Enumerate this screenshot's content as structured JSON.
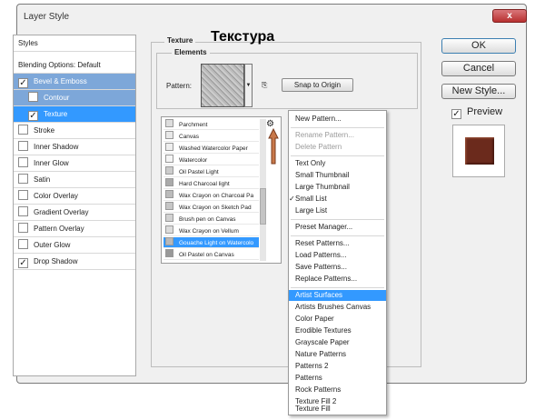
{
  "window": {
    "title": "Layer Style",
    "close_label": "x"
  },
  "styles_panel": {
    "header": "Styles",
    "blending": "Blending Options: Default",
    "items": [
      {
        "label": "Bevel & Emboss",
        "checked": true
      },
      {
        "label": "Contour",
        "checked": false
      },
      {
        "label": "Texture",
        "checked": true
      },
      {
        "label": "Stroke",
        "checked": false
      },
      {
        "label": "Inner Shadow",
        "checked": false
      },
      {
        "label": "Inner Glow",
        "checked": false
      },
      {
        "label": "Satin",
        "checked": false
      },
      {
        "label": "Color Overlay",
        "checked": false
      },
      {
        "label": "Gradient Overlay",
        "checked": false
      },
      {
        "label": "Pattern Overlay",
        "checked": false
      },
      {
        "label": "Outer Glow",
        "checked": false
      },
      {
        "label": "Drop Shadow",
        "checked": true
      }
    ]
  },
  "texture": {
    "legend": "Texture",
    "annotation": "Текстура",
    "elements_legend": "Elements",
    "pattern_label": "Pattern:",
    "snap_label": "Snap to Origin"
  },
  "pattern_list": [
    "Parchment",
    "Canvas",
    "Washed Watercolor Paper",
    "Watercolor",
    "Oil Pastel Light",
    "Hard Charcoal light",
    "Wax Crayon on Charcoal Pa",
    "Wax Crayon on Sketch Pad",
    "Brush pen on Canvas",
    "Wax Crayon on Vellum",
    "Gouache Light on Watercolo",
    "Oil Pastel on Canvas"
  ],
  "pattern_selected": "Gouache Light on Watercolo",
  "buttons": {
    "ok": "OK",
    "cancel": "Cancel",
    "new_style": "New Style...",
    "preview": "Preview"
  },
  "menu": {
    "new_pattern": "New Pattern...",
    "rename": "Rename Pattern...",
    "delete": "Delete Pattern",
    "text_only": "Text Only",
    "small_thumb": "Small Thumbnail",
    "large_thumb": "Large Thumbnail",
    "small_list": "Small List",
    "large_list": "Large List",
    "preset_manager": "Preset Manager...",
    "reset": "Reset Patterns...",
    "load": "Load Patterns...",
    "save": "Save Patterns...",
    "replace": "Replace Patterns...",
    "libraries": [
      "Artist Surfaces",
      "Artists Brushes Canvas",
      "Color Paper",
      "Erodible Textures",
      "Grayscale Paper",
      "Nature Patterns",
      "Patterns 2",
      "Patterns",
      "Rock Patterns",
      "Texture Fill 2",
      "Texture Fill"
    ],
    "checkmark": "✓"
  }
}
